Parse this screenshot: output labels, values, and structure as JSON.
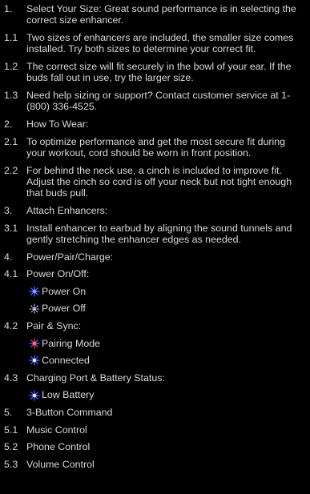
{
  "items": [
    {
      "num": "1.",
      "text": "Select Your Size: Great sound performance is in selecting the correct size enhancer."
    },
    {
      "num": "1.1",
      "text": "Two sizes of enhancers are included, the smaller size comes installed. Try both sizes to determine your correct fit."
    },
    {
      "num": "1.2",
      "text": "The correct size will fit securely in the bowl of your ear. If the buds fall out in use, try the larger size."
    },
    {
      "num": "1.3",
      "text": "Need help sizing or support? Contact customer service at 1-(800) 336-4525."
    },
    {
      "num": "2.",
      "text": "How To Wear:"
    },
    {
      "num": "2.1",
      "text": "To optimize performance and get the most secure fit during your workout, cord should be worn in front position."
    },
    {
      "num": "2.2",
      "text": "For behind the neck use, a cinch is included to improve fit. Adjust the cinch so cord is off your neck but not tight enough that buds pull."
    },
    {
      "num": "3.",
      "text": "Attach Enhancers:"
    },
    {
      "num": "3.1",
      "text": "Install enhancer to earbud by aligning the sound tunnels and gently stretching the enhancer edges as needed."
    },
    {
      "num": "4.",
      "text": "Power/Pair/Charge:"
    },
    {
      "num": "4.1",
      "text": "Power On/Off:"
    },
    {
      "num": "4.2",
      "text": "Pair & Sync:"
    },
    {
      "num": "4.3",
      "text": "Charging Port & Battery Status:"
    },
    {
      "num": "5.",
      "text": "3-Button Command"
    },
    {
      "num": "5.1",
      "text": "Music Control"
    },
    {
      "num": "5.2",
      "text": "Phone Control"
    },
    {
      "num": "5.3",
      "text": "Volume Control"
    }
  ],
  "indicators": {
    "power_on": {
      "label": "Power On",
      "icon": "blue-led-icon",
      "colors": [
        "#3a5bff"
      ]
    },
    "power_off": {
      "label": "Power Off",
      "icon": "off-led-icon",
      "colors": [
        "#cfd6ff"
      ]
    },
    "pairing_mode": {
      "label": "Pairing Mode",
      "icon": "red-blue-led-icon",
      "colors": [
        "#ff2a2a",
        "#3a5bff"
      ]
    },
    "connected": {
      "label": "Connected",
      "icon": "blue-led-icon",
      "colors": [
        "#3a5bff"
      ]
    },
    "low_battery": {
      "label": "Low Battery",
      "icon": "blue-led-icon",
      "colors": [
        "#3a5bff"
      ]
    }
  },
  "colors": {
    "background": "#000000",
    "text": "#d9d9d9"
  }
}
